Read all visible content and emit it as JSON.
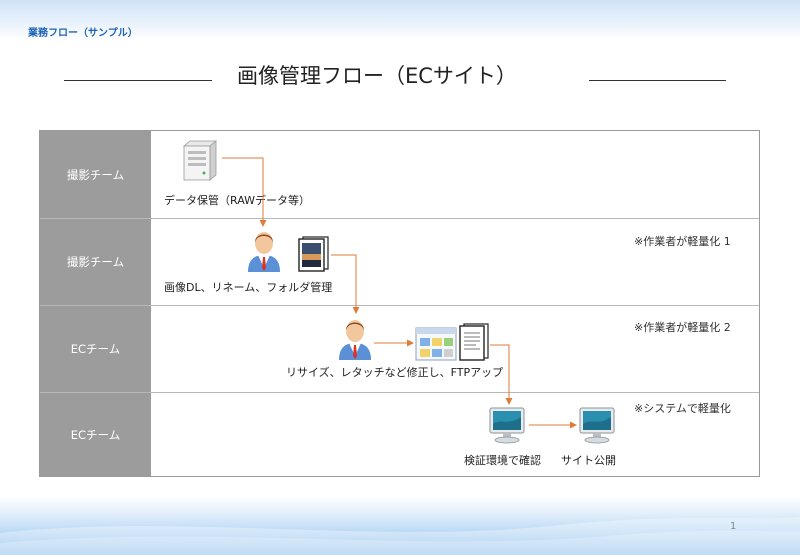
{
  "header": {
    "doc_label": "業務フロー（サンプル）"
  },
  "title": "画像管理フロー（ECサイト）",
  "lanes": [
    {
      "label": "撮影チーム",
      "note": ""
    },
    {
      "label": "撮影チーム",
      "note": "※作業者が軽量化 1"
    },
    {
      "label": "ECチーム",
      "note": "※作業者が軽量化 2"
    },
    {
      "label": "ECチーム",
      "note": "※システムで軽量化"
    }
  ],
  "steps": {
    "storage": "データ保管（RAWデータ等）",
    "download": "画像DL、リネーム、フォルダ管理",
    "resize": "リサイズ、レタッチなど修正し、FTPアップ",
    "verify": "検証環境で確認",
    "publish": "サイト公開"
  },
  "icons": [
    "server-icon",
    "person-icon",
    "photo-icon",
    "person-icon",
    "browser-window-icon",
    "document-icon",
    "monitor-icon",
    "monitor-icon"
  ],
  "colors": {
    "lane_header": "#9c9c9c",
    "arrow": "#e07b39"
  },
  "footer": {
    "page_number": "1"
  }
}
